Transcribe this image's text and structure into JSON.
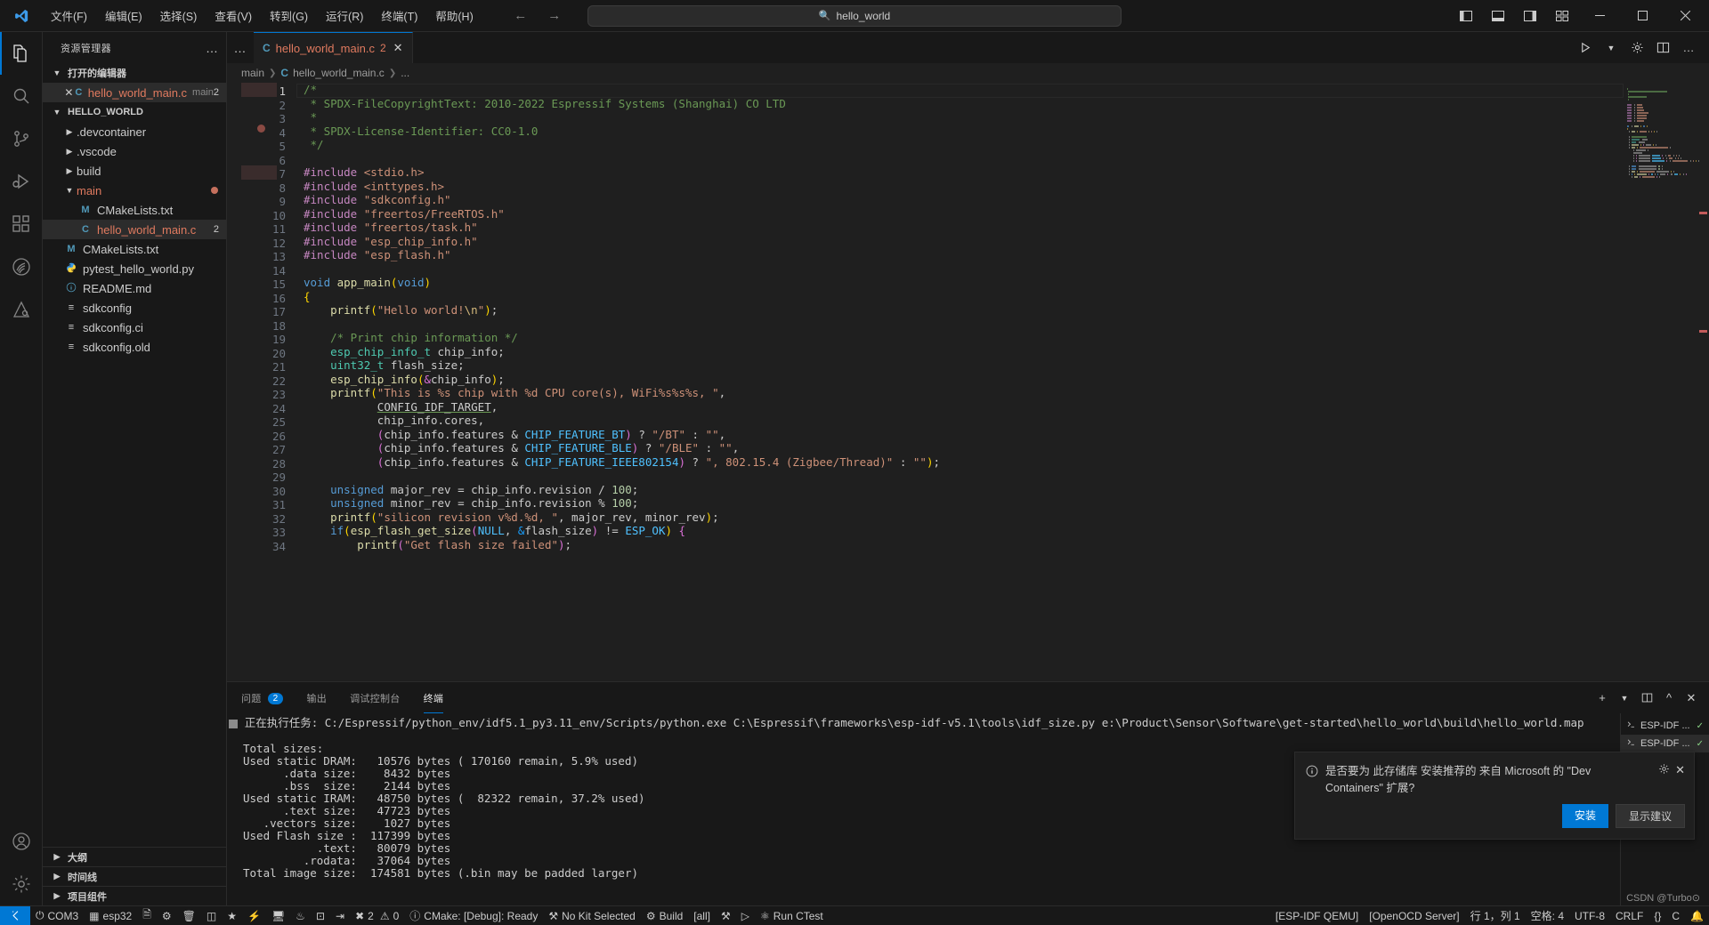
{
  "titlebar": {
    "logo_icon": "vscode-logo",
    "menus": [
      "文件(F)",
      "编辑(E)",
      "选择(S)",
      "查看(V)",
      "转到(G)",
      "运行(R)",
      "终端(T)",
      "帮助(H)"
    ],
    "nav_back_icon": "arrow-left-icon",
    "nav_forward_icon": "arrow-right-icon",
    "command_center_text": "hello_world",
    "command_center_icon": "search-icon",
    "layout_icons": [
      "toggle-primary-sidebar-icon",
      "toggle-panel-icon",
      "toggle-secondary-sidebar-icon",
      "customize-layout-icon"
    ],
    "window_buttons": [
      "minimize",
      "maximize",
      "close"
    ]
  },
  "activitybar": {
    "items": [
      {
        "name": "explorer",
        "icon": "files-icon",
        "active": true
      },
      {
        "name": "search",
        "icon": "search-icon",
        "active": false
      },
      {
        "name": "source-control",
        "icon": "source-control-icon",
        "active": false
      },
      {
        "name": "run-and-debug",
        "icon": "debug-icon",
        "active": false
      },
      {
        "name": "extensions",
        "icon": "extensions-icon",
        "active": false
      },
      {
        "name": "espressif-ide",
        "icon": "espressif-icon",
        "active": false
      },
      {
        "name": "platformio",
        "icon": "platformio-icon",
        "active": false
      }
    ],
    "bottom": [
      {
        "name": "accounts",
        "icon": "account-icon"
      },
      {
        "name": "manage",
        "icon": "gear-icon"
      }
    ]
  },
  "sidebar": {
    "title": "资源管理器",
    "more_actions_icon": "ellipsis-icon",
    "open_editors": {
      "label": "打开的编辑器",
      "items": [
        {
          "name": "hello_world_main.c",
          "suffix": "main",
          "badge": "2",
          "icon": "c-file-icon",
          "close_icon": "close-icon",
          "selected": true
        }
      ]
    },
    "workspace": {
      "label": "HELLO_WORLD",
      "items": [
        {
          "label": ".devcontainer",
          "type": "folder",
          "expanded": false,
          "indent": 1
        },
        {
          "label": ".vscode",
          "type": "folder",
          "expanded": false,
          "indent": 1
        },
        {
          "label": "build",
          "type": "folder",
          "expanded": false,
          "indent": 1
        },
        {
          "label": "main",
          "type": "folder",
          "expanded": true,
          "indent": 1,
          "dirty": true,
          "color": "#e07a5f"
        },
        {
          "label": "CMakeLists.txt",
          "type": "cmake",
          "indent": 2,
          "icon": "M",
          "icon_color": "#519aba"
        },
        {
          "label": "hello_world_main.c",
          "type": "c",
          "indent": 2,
          "icon": "C",
          "icon_color": "#519aba",
          "badge": "2",
          "selected": true,
          "color": "#e07a5f"
        },
        {
          "label": "CMakeLists.txt",
          "type": "cmake",
          "indent": 1,
          "icon": "M",
          "icon_color": "#519aba"
        },
        {
          "label": "pytest_hello_world.py",
          "type": "python",
          "indent": 1,
          "icon": "py",
          "icon_color": "#3572A5"
        },
        {
          "label": "README.md",
          "type": "markdown",
          "indent": 1,
          "icon": "i",
          "icon_color": "#519aba"
        },
        {
          "label": "sdkconfig",
          "type": "config",
          "indent": 1,
          "icon": "≡",
          "icon_color": "#cccccc"
        },
        {
          "label": "sdkconfig.ci",
          "type": "config",
          "indent": 1,
          "icon": "≡",
          "icon_color": "#cccccc"
        },
        {
          "label": "sdkconfig.old",
          "type": "config",
          "indent": 1,
          "icon": "≡",
          "icon_color": "#cccccc"
        }
      ]
    },
    "bottom_sections": [
      "大纲",
      "时间线",
      "项目组件"
    ]
  },
  "editor": {
    "tab": {
      "label": "hello_world_main.c",
      "icon": "C",
      "count": "2",
      "close_icon": "close-icon"
    },
    "tab_more_icon": "ellipsis-icon",
    "actions": [
      "run-icon",
      "chevron-down-icon",
      "settings-icon",
      "split-editor-icon",
      "more-actions-icon"
    ],
    "breadcrumb": [
      "main",
      "hello_world_main.c",
      "..."
    ],
    "language": "C",
    "code_lines": [
      {
        "n": 1,
        "tokens": [
          [
            "c-cmt",
            "/*"
          ]
        ]
      },
      {
        "n": 2,
        "tokens": [
          [
            "c-cmt",
            " * SPDX-FileCopyrightText: 2010-2022 Espressif Systems (Shanghai) CO LTD"
          ]
        ]
      },
      {
        "n": 3,
        "tokens": [
          [
            "c-cmt",
            " *"
          ]
        ]
      },
      {
        "n": 4,
        "tokens": [
          [
            "c-cmt",
            " * SPDX-License-Identifier: CC0-1.0"
          ]
        ]
      },
      {
        "n": 5,
        "tokens": [
          [
            "c-cmt",
            " */"
          ]
        ]
      },
      {
        "n": 6,
        "tokens": []
      },
      {
        "n": 7,
        "tokens": [
          [
            "c-pre",
            "#include"
          ],
          [
            "c-txt",
            " "
          ],
          [
            "c-str",
            "<stdio.h>"
          ]
        ]
      },
      {
        "n": 8,
        "tokens": [
          [
            "c-pre",
            "#include"
          ],
          [
            "c-txt",
            " "
          ],
          [
            "c-str",
            "<inttypes.h>"
          ]
        ]
      },
      {
        "n": 9,
        "tokens": [
          [
            "c-pre",
            "#include"
          ],
          [
            "c-txt",
            " "
          ],
          [
            "c-str",
            "\"sdkconfig.h\""
          ]
        ]
      },
      {
        "n": 10,
        "tokens": [
          [
            "c-pre",
            "#include"
          ],
          [
            "c-txt",
            " "
          ],
          [
            "c-str",
            "\"freertos/FreeRTOS.h\""
          ]
        ]
      },
      {
        "n": 11,
        "tokens": [
          [
            "c-pre",
            "#include"
          ],
          [
            "c-txt",
            " "
          ],
          [
            "c-str",
            "\"freertos/task.h\""
          ]
        ]
      },
      {
        "n": 12,
        "tokens": [
          [
            "c-pre",
            "#include"
          ],
          [
            "c-txt",
            " "
          ],
          [
            "c-str",
            "\"esp_chip_info.h\""
          ]
        ]
      },
      {
        "n": 13,
        "tokens": [
          [
            "c-pre",
            "#include"
          ],
          [
            "c-txt",
            " "
          ],
          [
            "c-str",
            "\"esp_flash.h\""
          ]
        ]
      },
      {
        "n": 14,
        "tokens": []
      },
      {
        "n": 15,
        "tokens": [
          [
            "c-kw",
            "void"
          ],
          [
            "c-txt",
            " "
          ],
          [
            "c-fn",
            "app_main"
          ],
          [
            "c-pl",
            "("
          ],
          [
            "c-kw",
            "void"
          ],
          [
            "c-pl",
            ")"
          ]
        ]
      },
      {
        "n": 16,
        "tokens": [
          [
            "c-pl",
            "{"
          ]
        ]
      },
      {
        "n": 17,
        "tokens": [
          [
            "c-txt",
            "    "
          ],
          [
            "c-fn",
            "printf"
          ],
          [
            "c-pl",
            "("
          ],
          [
            "c-str",
            "\"Hello world!"
          ],
          [
            "c-esc",
            "\\n"
          ],
          [
            "c-str",
            "\""
          ],
          [
            "c-pl",
            ")"
          ],
          [
            "c-txt",
            ";"
          ]
        ]
      },
      {
        "n": 18,
        "tokens": []
      },
      {
        "n": 19,
        "tokens": [
          [
            "c-txt",
            "    "
          ],
          [
            "c-cmt",
            "/* Print chip information */"
          ]
        ]
      },
      {
        "n": 20,
        "tokens": [
          [
            "c-txt",
            "    "
          ],
          [
            "c-typ",
            "esp_chip_info_t"
          ],
          [
            "c-txt",
            " chip_info;"
          ]
        ]
      },
      {
        "n": 21,
        "tokens": [
          [
            "c-txt",
            "    "
          ],
          [
            "c-typ",
            "uint32_t"
          ],
          [
            "c-txt",
            " flash_size;"
          ]
        ]
      },
      {
        "n": 22,
        "tokens": [
          [
            "c-txt",
            "    "
          ],
          [
            "c-fn",
            "esp_chip_info"
          ],
          [
            "c-pl",
            "("
          ],
          [
            "c-p2",
            "&"
          ],
          [
            "c-txt",
            "chip_info"
          ],
          [
            "c-pl",
            ")"
          ],
          [
            "c-txt",
            ";"
          ]
        ]
      },
      {
        "n": 23,
        "tokens": [
          [
            "c-txt",
            "    "
          ],
          [
            "c-fn",
            "printf"
          ],
          [
            "c-pl",
            "("
          ],
          [
            "c-str",
            "\"This is %s chip with %d CPU core(s), WiFi%s%s%s, \""
          ],
          [
            "c-txt",
            ","
          ]
        ]
      },
      {
        "n": 24,
        "tokens": [
          [
            "c-txt",
            "           "
          ],
          [
            "c-und c-txt",
            "CONFIG_IDF_TARGET"
          ],
          [
            "c-txt",
            ","
          ]
        ]
      },
      {
        "n": 25,
        "tokens": [
          [
            "c-txt",
            "           chip_info.cores,"
          ]
        ]
      },
      {
        "n": 26,
        "tokens": [
          [
            "c-txt",
            "           "
          ],
          [
            "c-p2",
            "("
          ],
          [
            "c-txt",
            "chip_info.features & "
          ],
          [
            "c-cst",
            "CHIP_FEATURE_BT"
          ],
          [
            "c-p2",
            ")"
          ],
          [
            "c-txt",
            " ? "
          ],
          [
            "c-str",
            "\"/BT\""
          ],
          [
            "c-txt",
            " : "
          ],
          [
            "c-str",
            "\"\""
          ],
          [
            "c-txt",
            ","
          ]
        ]
      },
      {
        "n": 27,
        "tokens": [
          [
            "c-txt",
            "           "
          ],
          [
            "c-p2",
            "("
          ],
          [
            "c-txt",
            "chip_info.features & "
          ],
          [
            "c-cst",
            "CHIP_FEATURE_BLE"
          ],
          [
            "c-p2",
            ")"
          ],
          [
            "c-txt",
            " ? "
          ],
          [
            "c-str",
            "\"/BLE\""
          ],
          [
            "c-txt",
            " : "
          ],
          [
            "c-str",
            "\"\""
          ],
          [
            "c-txt",
            ","
          ]
        ]
      },
      {
        "n": 28,
        "tokens": [
          [
            "c-txt",
            "           "
          ],
          [
            "c-p2",
            "("
          ],
          [
            "c-txt",
            "chip_info.features & "
          ],
          [
            "c-cst",
            "CHIP_FEATURE_IEEE802154"
          ],
          [
            "c-p2",
            ")"
          ],
          [
            "c-txt",
            " ? "
          ],
          [
            "c-str",
            "\", 802.15.4 (Zigbee/Thread)\""
          ],
          [
            "c-txt",
            " : "
          ],
          [
            "c-str",
            "\"\""
          ],
          [
            "c-pl",
            ")"
          ],
          [
            "c-txt",
            ";"
          ]
        ]
      },
      {
        "n": 29,
        "tokens": []
      },
      {
        "n": 30,
        "tokens": [
          [
            "c-txt",
            "    "
          ],
          [
            "c-kw",
            "unsigned"
          ],
          [
            "c-txt",
            " major_rev = chip_info.revision / "
          ],
          [
            "c-num",
            "100"
          ],
          [
            "c-txt",
            ";"
          ]
        ]
      },
      {
        "n": 31,
        "tokens": [
          [
            "c-txt",
            "    "
          ],
          [
            "c-kw",
            "unsigned"
          ],
          [
            "c-txt",
            " minor_rev = chip_info.revision % "
          ],
          [
            "c-num",
            "100"
          ],
          [
            "c-txt",
            ";"
          ]
        ]
      },
      {
        "n": 32,
        "tokens": [
          [
            "c-txt",
            "    "
          ],
          [
            "c-fn",
            "printf"
          ],
          [
            "c-pl",
            "("
          ],
          [
            "c-str",
            "\"silicon revision v%d.%d, \""
          ],
          [
            "c-txt",
            ", major_rev, minor_rev"
          ],
          [
            "c-pl",
            ")"
          ],
          [
            "c-txt",
            ";"
          ]
        ]
      },
      {
        "n": 33,
        "tokens": [
          [
            "c-txt",
            "    "
          ],
          [
            "c-kw",
            "if"
          ],
          [
            "c-pl",
            "("
          ],
          [
            "c-fn",
            "esp_flash_get_size"
          ],
          [
            "c-p2",
            "("
          ],
          [
            "c-cst",
            "NULL"
          ],
          [
            "c-txt",
            ", "
          ],
          [
            "c-p3",
            "&"
          ],
          [
            "c-txt",
            "flash_size"
          ],
          [
            "c-p2",
            ")"
          ],
          [
            "c-txt",
            " != "
          ],
          [
            "c-cst",
            "ESP_OK"
          ],
          [
            "c-pl",
            ")"
          ],
          [
            "c-txt",
            " "
          ],
          [
            "c-p2",
            "{"
          ]
        ]
      },
      {
        "n": 34,
        "tokens": [
          [
            "c-txt",
            "        "
          ],
          [
            "c-fn",
            "printf"
          ],
          [
            "c-p2",
            "("
          ],
          [
            "c-str",
            "\"Get flash size failed\""
          ],
          [
            "c-p2",
            ")"
          ],
          [
            "c-txt",
            ";"
          ]
        ]
      }
    ]
  },
  "panel": {
    "tabs": [
      {
        "label": "问题",
        "badge": "2",
        "active": false
      },
      {
        "label": "输出",
        "badge": null,
        "active": false
      },
      {
        "label": "调试控制台",
        "badge": null,
        "active": false
      },
      {
        "label": "终端",
        "badge": null,
        "active": true
      }
    ],
    "actions": [
      "new-terminal-icon",
      "split-terminal-icon",
      "chevron-down-icon",
      "maximize-panel-icon",
      "close-panel-icon"
    ],
    "terminal_lines": [
      "正在执行任务: C:/Espressif/python_env/idf5.1_py3.11_env/Scripts/python.exe C:\\Espressif\\frameworks\\esp-idf-v5.1\\tools\\idf_size.py e:\\Product\\Sensor\\Software\\get-started\\hello_world\\build\\hello_world.map",
      "",
      "Total sizes:",
      "Used static DRAM:   10576 bytes ( 170160 remain, 5.9% used)",
      "      .data size:    8432 bytes",
      "      .bss  size:    2144 bytes",
      "Used static IRAM:   48750 bytes (  82322 remain, 37.2% used)",
      "      .text size:   47723 bytes",
      "   .vectors size:    1027 bytes",
      "Used Flash size :  117399 bytes",
      "           .text:   80079 bytes",
      "         .rodata:   37064 bytes",
      "Total image size:  174581 bytes (.bin may be padded larger)"
    ],
    "terminal_prefix": "正在执行任务: ",
    "terminal_list": [
      {
        "label": "ESP-IDF ...",
        "icon": "terminal-icon",
        "check": "✓",
        "selected": false
      },
      {
        "label": "ESP-IDF ...",
        "icon": "terminal-icon",
        "check": "✓",
        "selected": true
      }
    ]
  },
  "notification": {
    "info_icon": "info-icon",
    "message": "是否要为 此存储库 安装推荐的 来自 Microsoft 的 \"Dev Containers\" 扩展?",
    "gear_icon": "gear-icon",
    "close_icon": "close-icon",
    "primary_button": "安装",
    "secondary_button": "显示建议"
  },
  "statusbar": {
    "remote_icon": "remote-indicator-icon",
    "left_items": [
      {
        "label": "COM3",
        "icon": "plug-icon"
      },
      {
        "label": "esp32",
        "icon": "chip-icon"
      },
      {
        "label": "",
        "icon": "book-icon"
      },
      {
        "label": "",
        "icon": "gear-icon"
      },
      {
        "label": "",
        "icon": "trash-icon"
      },
      {
        "label": "",
        "icon": "database-icon"
      },
      {
        "label": "",
        "icon": "star-icon"
      },
      {
        "label": "",
        "icon": "zap-icon"
      },
      {
        "label": "",
        "icon": "monitor-icon"
      },
      {
        "label": "",
        "icon": "flame-icon"
      },
      {
        "label": "",
        "icon": "terminal-icon"
      },
      {
        "label": "",
        "icon": "login-icon"
      },
      {
        "label": "2",
        "icon": "error-icon",
        "label2": "0",
        "icon2": "warning-icon"
      },
      {
        "label": "CMake: [Debug]: Ready",
        "icon": "info-icon"
      },
      {
        "label": "No Kit Selected",
        "icon": "tools-icon"
      },
      {
        "label": "Build",
        "icon": "gear-icon"
      },
      {
        "label": "[all]",
        "icon": ""
      },
      {
        "label": "",
        "icon": "bug-icon"
      },
      {
        "label": "",
        "icon": "play-icon"
      },
      {
        "label": "Run CTest",
        "icon": "beaker-icon"
      }
    ],
    "right_items": [
      {
        "label": "[ESP-IDF QEMU]"
      },
      {
        "label": "[OpenOCD Server]"
      },
      {
        "label": "行 1，列 1"
      },
      {
        "label": "空格: 4"
      },
      {
        "label": "UTF-8"
      },
      {
        "label": "CRLF"
      },
      {
        "label": "{}"
      },
      {
        "label": "C"
      },
      {
        "label": "bell-icon"
      }
    ],
    "watermark": "CSDN @Turbo⊙"
  }
}
